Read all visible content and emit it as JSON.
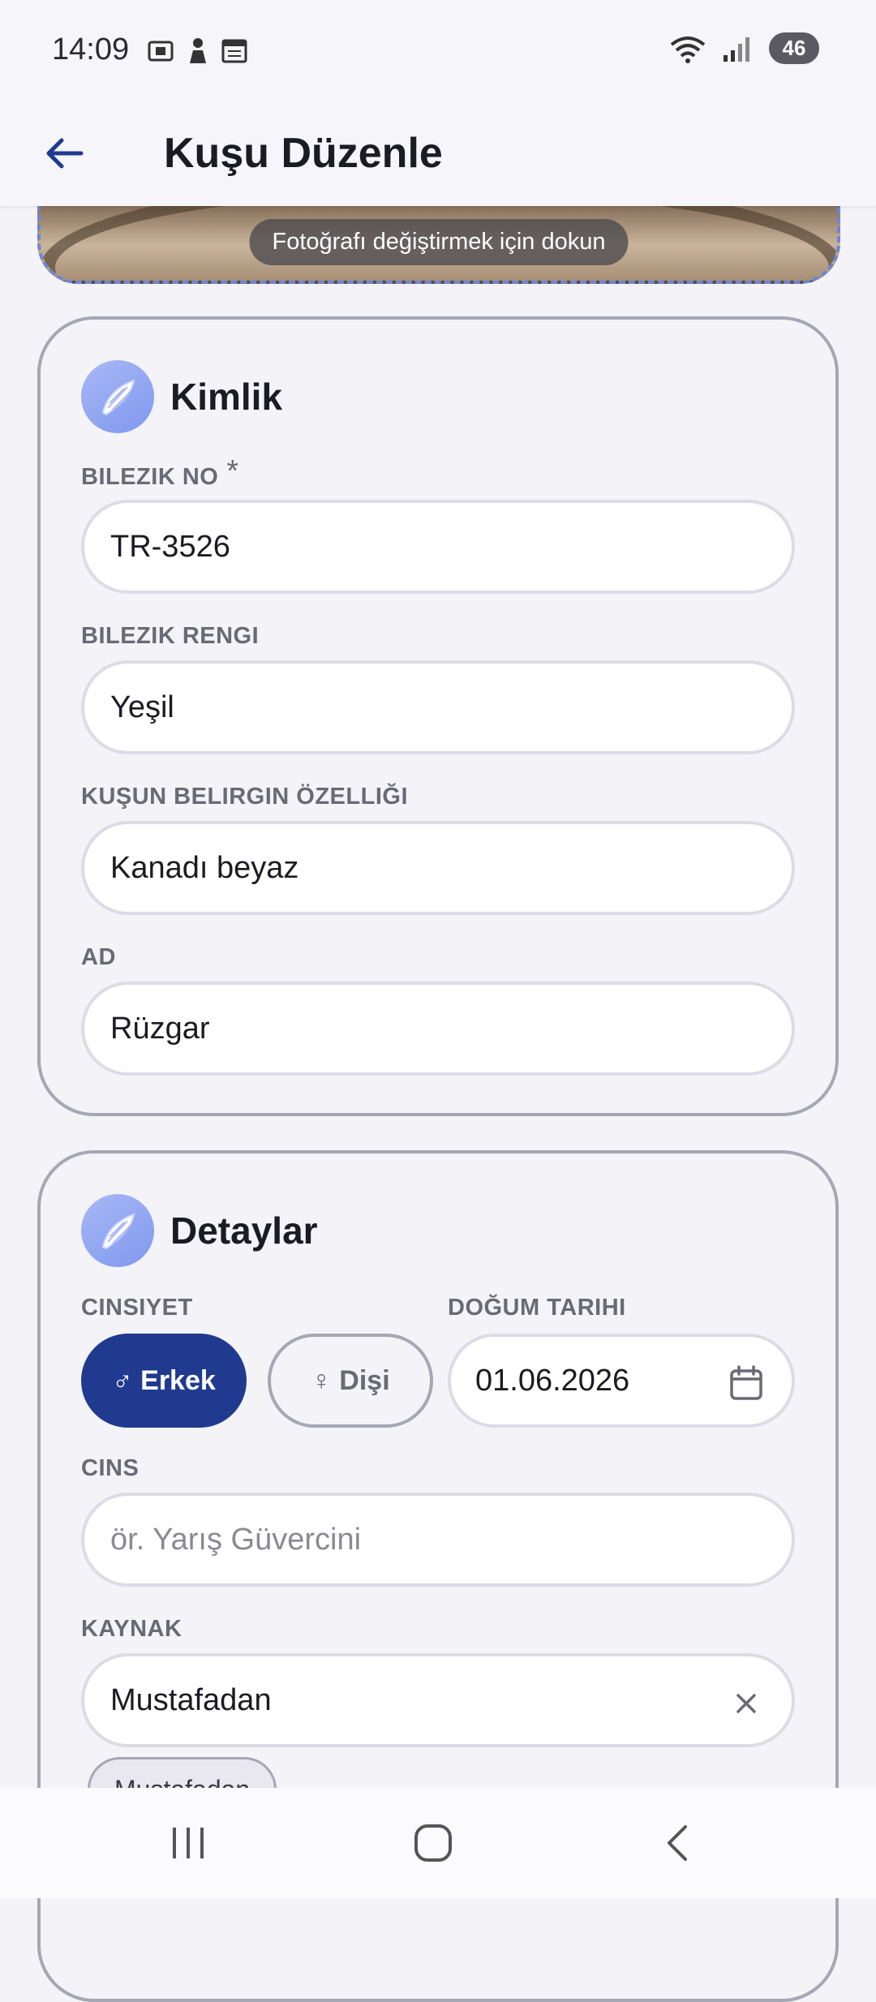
{
  "status_bar": {
    "time": "14:09",
    "battery": "46",
    "icons": [
      "screenshot-icon",
      "person-icon",
      "calendar-icon",
      "wifi-icon",
      "signal-icon",
      "battery-icon"
    ]
  },
  "app_bar": {
    "title": "Kuşu Düzenle",
    "back_icon": "arrow-left-icon"
  },
  "photo": {
    "hint": "Fotoğrafı değiştirmek için dokun"
  },
  "identity": {
    "title": "Kimlik",
    "ring_no_label": "BILEZIK NO",
    "required_mark": "*",
    "ring_no_value": "TR-3526",
    "ring_color_label": "BILEZIK RENGI",
    "ring_color_value": "Yeşil",
    "feature_label": "KUŞUN BELIRGIN ÖZELLIĞI",
    "feature_value": "Kanadı beyaz",
    "name_label": "AD",
    "name_value": "Rüzgar"
  },
  "details": {
    "title": "Detaylar",
    "gender_label": "CINSIYET",
    "male_label": "♂ Erkek",
    "female_label": "♀ Dişi",
    "gender_selected": "male",
    "birth_label": "DOĞUM TARIHI",
    "birth_value": "01.06.2026",
    "breed_label": "CINS",
    "breed_placeholder": "ör. Yarış Güvercini",
    "source_label": "KAYNAK",
    "source_value": "Mustafadan",
    "source_chip": "Mustafadan"
  },
  "colors": {
    "accent": "#1f3a8f",
    "icon_bg": "#8da3f0",
    "card_border": "#a6a6b4",
    "photo_border": "#6f86d6"
  }
}
